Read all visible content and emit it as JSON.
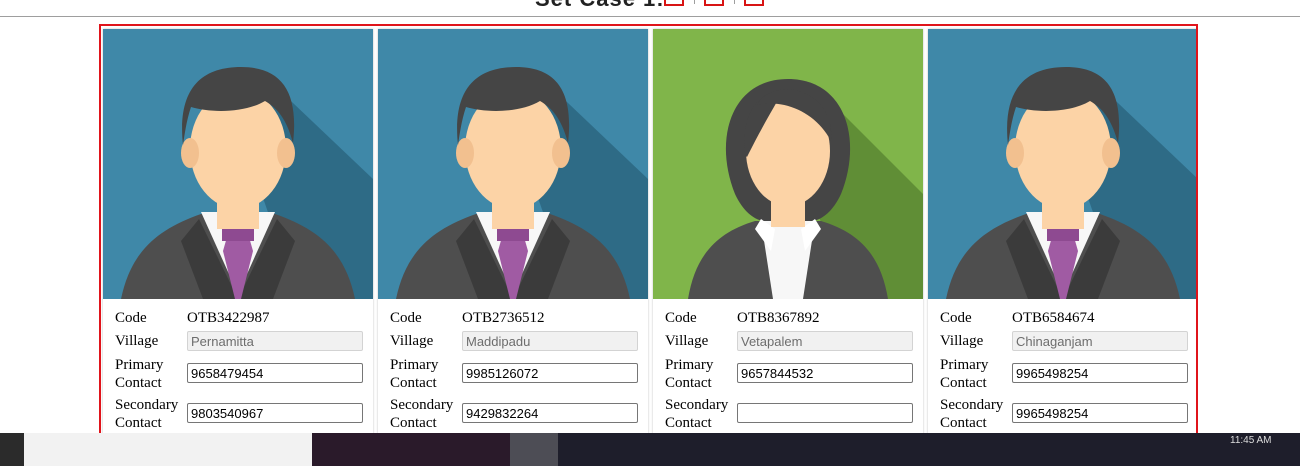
{
  "header": {
    "title": "Set Case 1:"
  },
  "labels": {
    "code": "Code",
    "village": "Village",
    "primary_1": "Primary",
    "primary_2": "Contact",
    "secondary_1": "Secondary",
    "secondary_2": "Contact"
  },
  "cards": [
    {
      "avatar": "male-avatar",
      "bg": "#3f88a8",
      "code": "OTB3422987",
      "village": "Pernamitta",
      "primary": "9658479454",
      "secondary": "9803540967"
    },
    {
      "avatar": "male-avatar",
      "bg": "#3f88a8",
      "code": "OTB2736512",
      "village": "Maddipadu",
      "primary": "9985126072",
      "secondary": "9429832264"
    },
    {
      "avatar": "female-avatar",
      "bg": "#80b54a",
      "code": "OTB8367892",
      "village": "Vetapalem",
      "primary": "9657844532",
      "secondary": ""
    },
    {
      "avatar": "male-avatar",
      "bg": "#3f88a8",
      "code": "OTB6584674",
      "village": "Chinaganjam",
      "primary": "9965498254",
      "secondary": "9965498254"
    }
  ],
  "taskbar": {
    "clock": "11:45 AM"
  },
  "colors": {
    "frame": "#e0141b",
    "male_bg": "#3f88a8",
    "female_bg": "#80b54a",
    "tie": "#a05ba3",
    "suit": "#4e4e4e",
    "hair": "#454545",
    "skin": "#fcd3a6"
  }
}
